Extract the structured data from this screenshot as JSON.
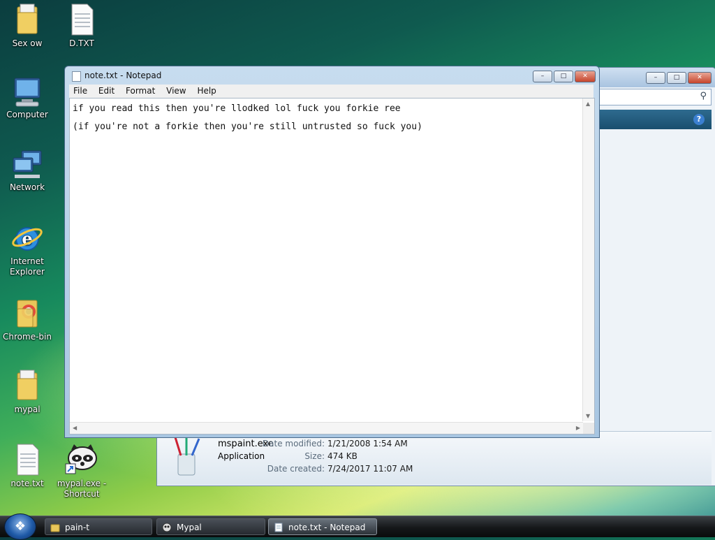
{
  "desktop": {
    "icons": [
      {
        "label": "Sex ow"
      },
      {
        "label": "D.TXT"
      },
      {
        "label": "Computer"
      },
      {
        "label": "Network"
      },
      {
        "label": "Internet Explorer"
      },
      {
        "label": "Chrome-bin"
      },
      {
        "label": "mypal"
      },
      {
        "label": "note.txt"
      },
      {
        "label": "mypal.exe - Shortcut"
      }
    ]
  },
  "explorer": {
    "details": {
      "file_name": "mspaint.exe",
      "file_type": "Application",
      "date_modified_label": "Date modified:",
      "date_modified": "1/21/2008 1:54 AM",
      "size_label": "Size:",
      "size": "474 KB",
      "date_created_label": "Date created:",
      "date_created": "7/24/2017 11:07 AM"
    }
  },
  "notepad": {
    "title": "note.txt - Notepad",
    "menu": [
      "File",
      "Edit",
      "Format",
      "View",
      "Help"
    ],
    "lines": [
      "if you read this then you're llodked lol fuck you forkie ree",
      "(if you're not a forkie then you're still untrusted so fuck you)"
    ]
  },
  "taskbar": {
    "items": [
      {
        "label": "pain-t"
      },
      {
        "label": "Mypal"
      },
      {
        "label": "note.txt - Notepad"
      }
    ]
  }
}
